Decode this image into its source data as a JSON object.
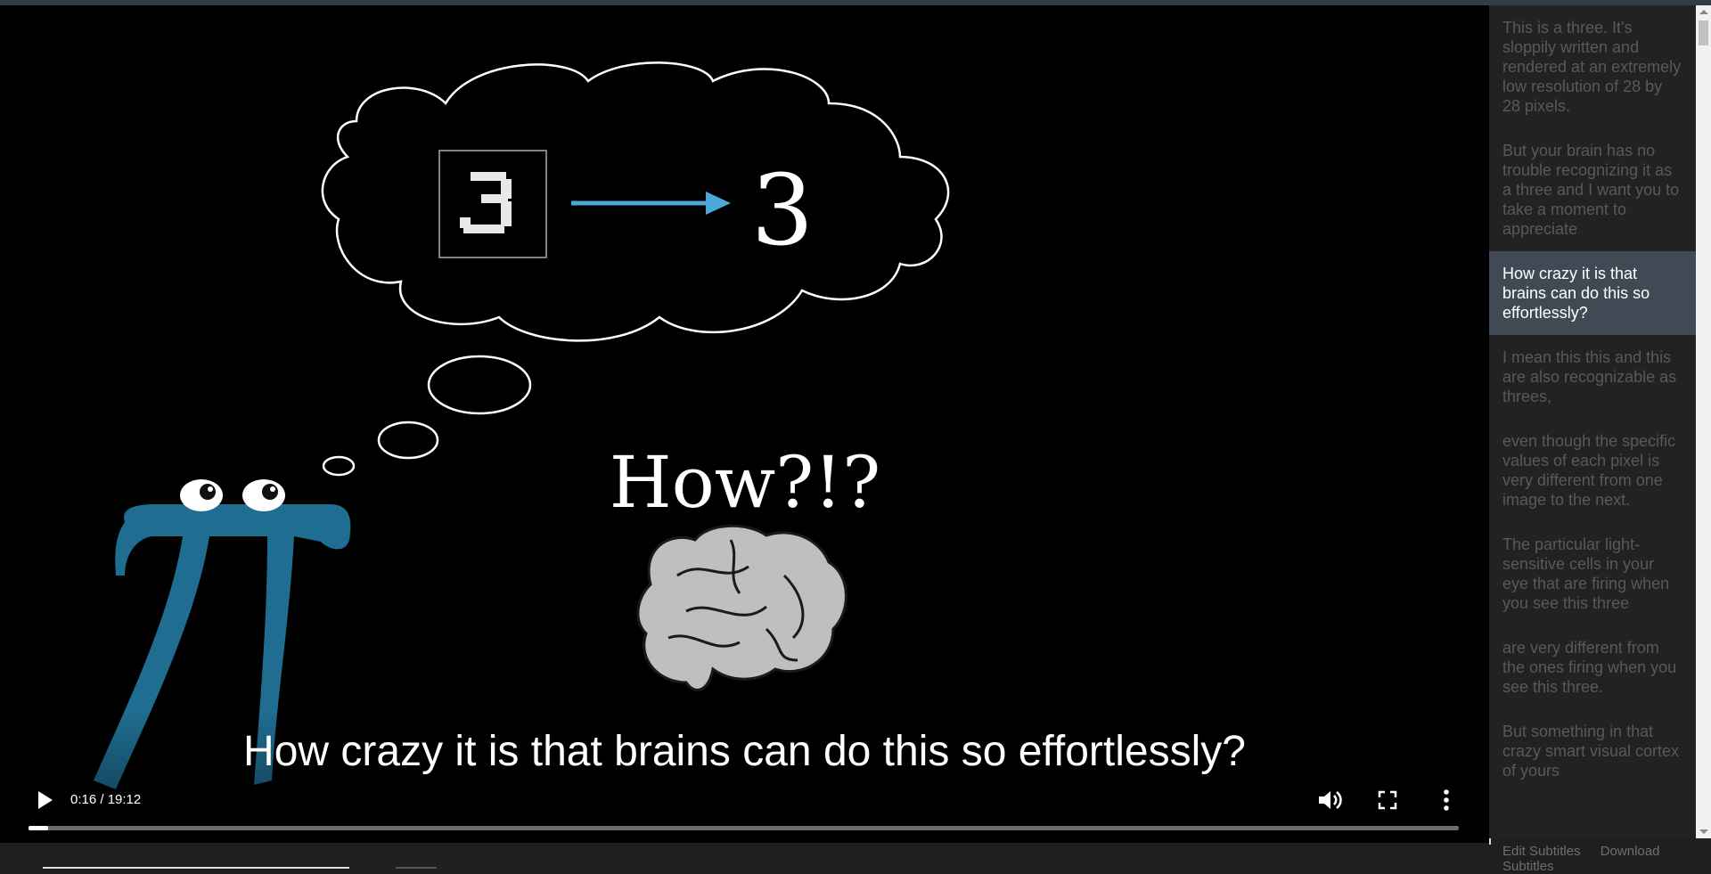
{
  "video": {
    "formula_target": "3",
    "question": "How?!?",
    "caption": "How crazy it is that brains can do this so effortlessly?",
    "time": "0:16 / 19:12",
    "progress_fraction": 0.014,
    "accent_color": "#2d8db1"
  },
  "controls": {
    "play_icon": "play-icon",
    "volume_icon": "volume-icon",
    "fullscreen_icon": "fullscreen-icon",
    "more_icon": "more-vert-icon"
  },
  "subtitles": [
    {
      "text": "This is a three. It's sloppily written and rendered at an extremely low resolution of 28 by 28 pixels.",
      "active": false
    },
    {
      "text": "But your brain has no trouble recognizing it as a three and I want you to take a moment to appreciate",
      "active": false
    },
    {
      "text": "How crazy it is that brains can do this so effortlessly?",
      "active": true
    },
    {
      "text": "I mean this this and this are also recognizable as threes,",
      "active": false
    },
    {
      "text": "even though the specific values of each pixel is very different from one image to the next.",
      "active": false
    },
    {
      "text": "The particular light-sensitive cells in your eye that are firing when you see this three",
      "active": false
    },
    {
      "text": "are very different from the ones firing when you see this three.",
      "active": false
    },
    {
      "text": "But something in that crazy smart visual cortex of yours",
      "active": false
    }
  ],
  "footer": {
    "edit_label": "Edit Subtitles",
    "download_label": "Download Subtitles"
  }
}
